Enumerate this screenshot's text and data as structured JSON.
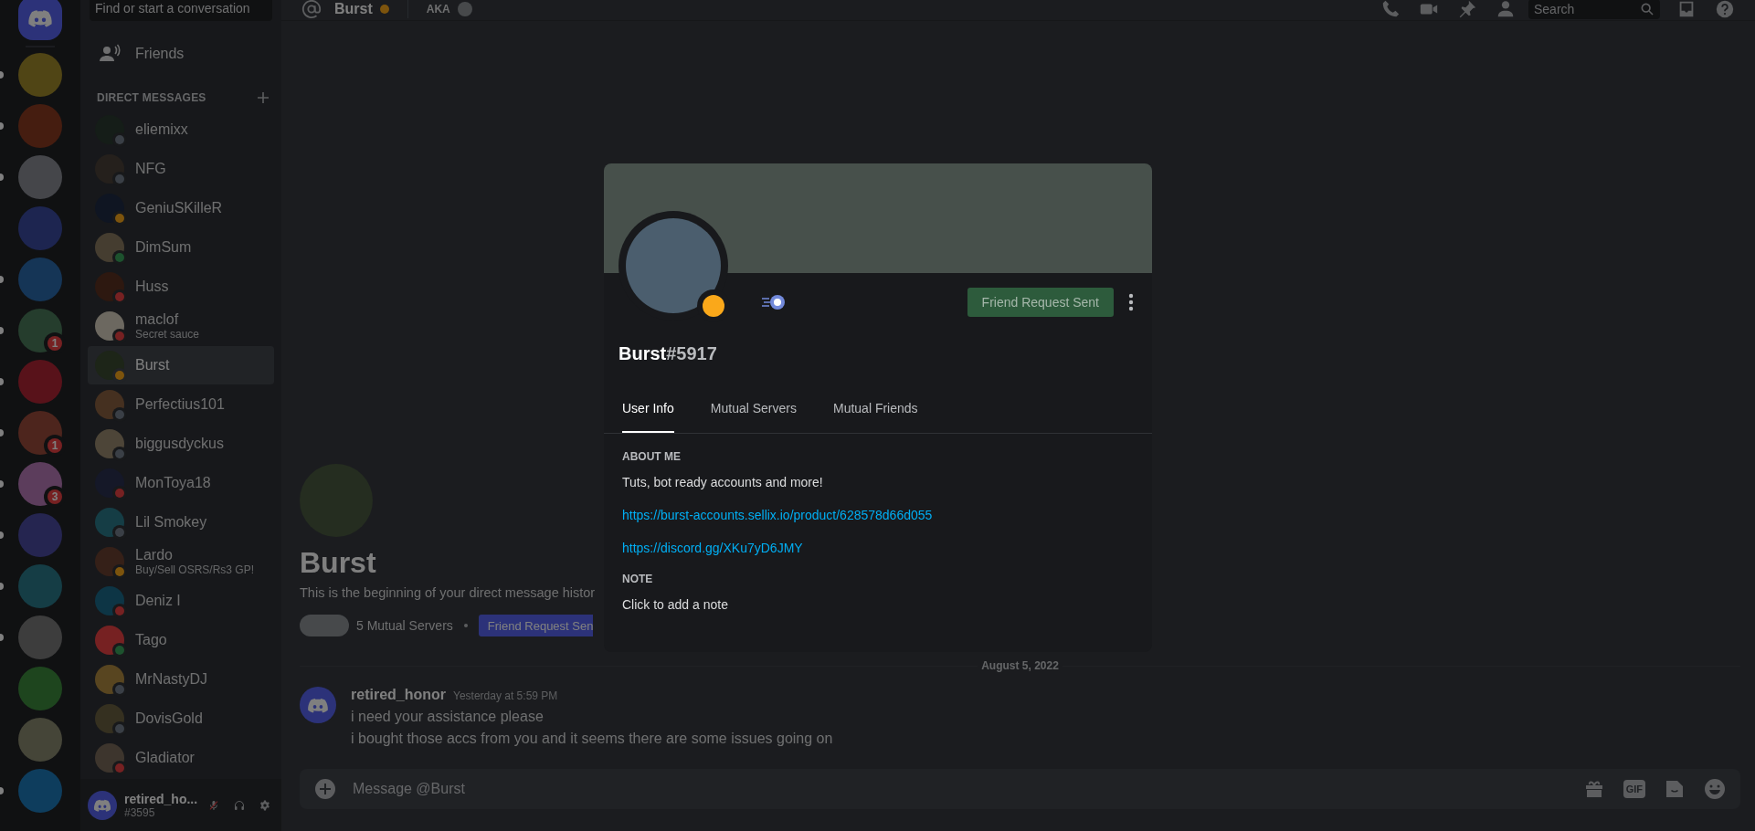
{
  "server_rail": {
    "servers": [
      {
        "unread": true
      },
      {
        "unread": true
      },
      {
        "unread": true
      },
      {
        "unread": false
      },
      {
        "unread": true
      },
      {
        "unread": true,
        "badge": "1"
      },
      {
        "unread": true
      },
      {
        "unread": true,
        "badge": "1"
      },
      {
        "unread": true,
        "badge": "3"
      },
      {
        "unread": true
      },
      {
        "unread": true
      },
      {
        "unread": true
      },
      {
        "unread": false
      },
      {
        "unread": false
      },
      {
        "unread": true
      }
    ]
  },
  "dm_sidebar": {
    "search": {
      "placeholder": "Find or start a conversation"
    },
    "friends": "Friends",
    "section_title": "DIRECT MESSAGES",
    "dms": [
      {
        "name": "eliemixx",
        "color": "#3a3f46",
        "selected": false
      },
      {
        "name": "NFG",
        "color": "#3a3f46",
        "selected": false
      },
      {
        "name": "GeniuSKilleR",
        "color": "#7d540d",
        "selected": false
      },
      {
        "name": "DimSum",
        "color": "#1d522e",
        "selected": false
      },
      {
        "name": "Huss",
        "color": "#762122",
        "selected": false
      },
      {
        "name": "maclof",
        "subtitle": "Secret sauce",
        "color": "#762122",
        "selected": false
      },
      {
        "name": "Burst",
        "color": "#7d540d",
        "selected": true
      },
      {
        "name": "Perfectius101",
        "color": "#3a3f46",
        "selected": false
      },
      {
        "name": "biggusdyckus",
        "color": "#3a3f46",
        "selected": false
      },
      {
        "name": "MonToya18",
        "color": "#762122",
        "selected": false
      },
      {
        "name": "Lil Smokey",
        "color": "#3a3f46",
        "selected": false
      },
      {
        "name": "Lardo",
        "subtitle": "Buy/Sell OSRS/Rs3 GP!",
        "color": "#7d540d",
        "selected": false
      },
      {
        "name": "Deniz I",
        "color": "#762122",
        "selected": false
      },
      {
        "name": "Tago",
        "color": "#1d522e",
        "selected": false
      },
      {
        "name": "MrNastyDJ",
        "color": "#3a3f46",
        "selected": false
      },
      {
        "name": "DovisGold",
        "color": "#3a3f46",
        "selected": false
      },
      {
        "name": "Gladiator",
        "color": "#762122",
        "selected": false
      }
    ]
  },
  "user_panel": {
    "name": "retired_ho...",
    "tag": "#3595",
    "muted": true
  },
  "header": {
    "name": "Burst",
    "status": {
      "color": "#7d540d"
    },
    "tag": "AKA",
    "search": {
      "placeholder": "Search"
    }
  },
  "chat": {
    "intro": {
      "name": "Burst",
      "text": "This is the beginning of your direct message histor",
      "mutual": "5 Mutual Servers",
      "button": "Friend Request Sen"
    },
    "date_divider": "August 5, 2022",
    "messages": [
      {
        "author": "retired_honor",
        "time": "Yesterday at 5:59 PM",
        "lines": [
          "i need your assistance please",
          "i bought those accs from you and it seems there are some issues going on"
        ]
      }
    ],
    "composer": {
      "placeholder": "Message @Burst",
      "gif": "GIF"
    }
  },
  "profile_modal": {
    "username": "Burst",
    "discriminator": "#5917",
    "status": {
      "color": "#faa81a"
    },
    "button": "Friend Request Sent",
    "tabs": [
      {
        "label": "User Info",
        "selected": true
      },
      {
        "label": "Mutual Servers",
        "selected": false
      },
      {
        "label": "Mutual Friends",
        "selected": false
      }
    ],
    "sections": [
      {
        "title": "ABOUT ME",
        "items": [
          {
            "kind": "text",
            "text": "Tuts, bot ready accounts and more!"
          },
          {
            "kind": "link",
            "text": "https://burst-accounts.sellix.io/product/628578d66d055"
          },
          {
            "kind": "link",
            "text": "https://discord.gg/XKu7yD6JMY"
          }
        ]
      },
      {
        "title": "NOTE",
        "items": [
          {
            "kind": "note",
            "text": "Click to add a note"
          }
        ]
      }
    ]
  }
}
